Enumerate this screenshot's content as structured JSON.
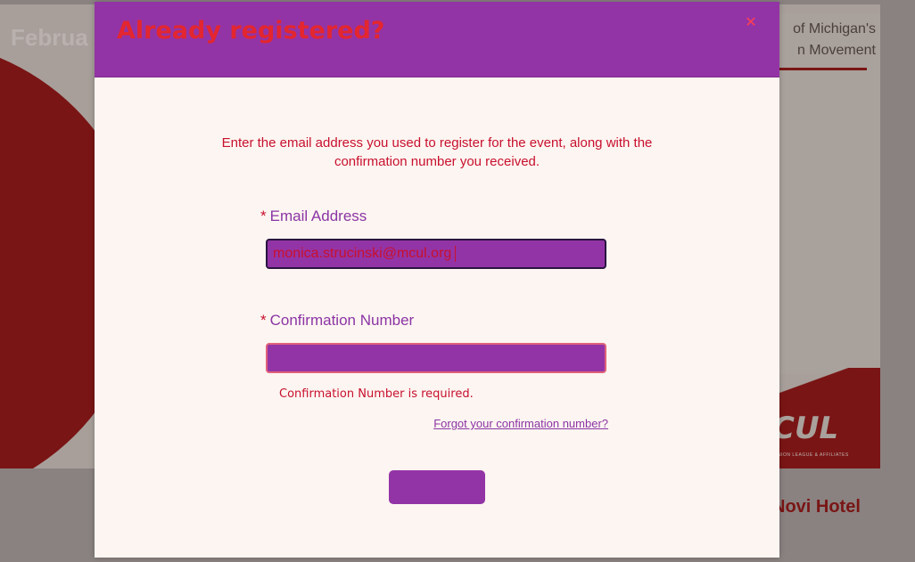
{
  "background": {
    "banner_date": "Februa",
    "tagline_lines": [
      "of Michigan's",
      "n Movement"
    ],
    "logo_text": "CUL",
    "logo_subtext": "NION LEAGUE & AFFILIATES",
    "venue": "Novi Hotel"
  },
  "modal": {
    "title": "Already registered?",
    "close_icon": "close-icon",
    "intro": "Enter the email address you used to register for the event, along with the confirmation number you received.",
    "email": {
      "required_mark": "*",
      "label": "Email Address",
      "value": "monica.strucinski@mcul.org"
    },
    "confirmation": {
      "required_mark": "*",
      "label": "Confirmation Number",
      "value": "",
      "error": "Confirmation Number is required."
    },
    "forgot_link": "Forgot your confirmation number?",
    "submit_label": ""
  },
  "colors": {
    "modal_header": "#9334a6",
    "title": "#e3262f",
    "accent_red": "#c8102e",
    "label_purple": "#8b35a5",
    "modal_body": "#fdf5f1"
  }
}
